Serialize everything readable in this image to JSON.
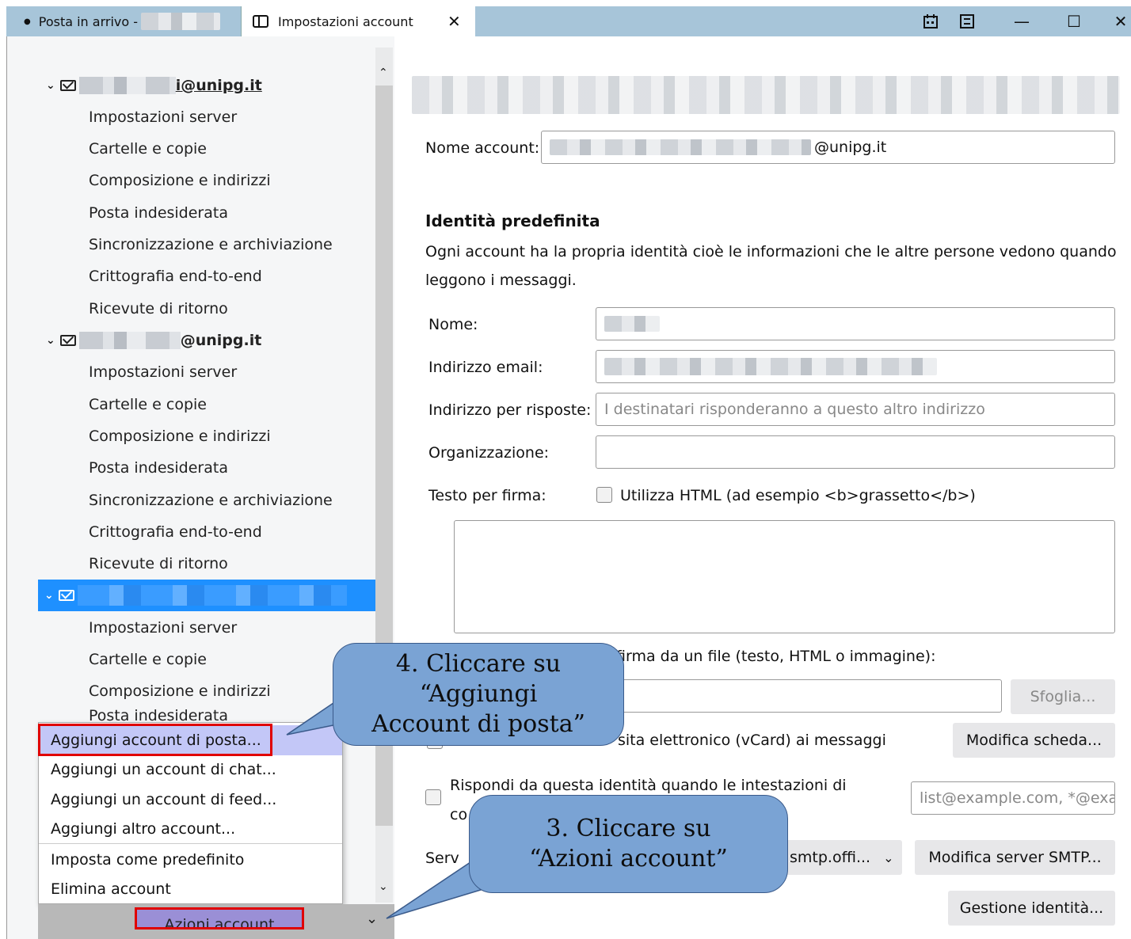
{
  "titlebar": {
    "tab1_label": "Posta in arrivo -",
    "tab2_label": "Impostazioni account",
    "close_tab": "✕",
    "minimize": "—",
    "maximize": "☐",
    "close": "✕"
  },
  "tree": {
    "account1_suffix": "i@unipg.it",
    "account2_suffix": "@unipg.it",
    "items": [
      "Impostazioni server",
      "Cartelle e copie",
      "Composizione e indirizzi",
      "Posta indesiderata",
      "Sincronizzazione e archiviazione",
      "Crittografia end-to-end",
      "Ricevute di ritorno"
    ],
    "partial_item": "Posta indesiderata"
  },
  "menu": {
    "items": [
      "Aggiungi account di posta...",
      "Aggiungi un account di chat...",
      "Aggiungi un account di feed...",
      "Aggiungi altro account...",
      "Imposta come predefinito",
      "Elimina account"
    ]
  },
  "action_button": "Azioni account",
  "settings": {
    "account_name_label": "Nome account:",
    "account_name_suffix": "@unipg.it",
    "identity_heading": "Identità predefinita",
    "identity_desc_1": "Ogni account ha la propria identità cioè le informazioni che le altre persone vedono quando",
    "identity_desc_2": "leggono i messaggi.",
    "name_label": "Nome:",
    "email_label": "Indirizzo email:",
    "reply_label": "Indirizzo per risposte:",
    "reply_placeholder": "I destinatari risponderanno a questo altro indirizzo",
    "org_label": "Organizzazione:",
    "sig_label": "Testo per firma:",
    "html_checkbox": "Utilizza HTML (ad esempio <b>grassetto</b>)",
    "file_sig_text": "firma da un file (testo, HTML o immagine):",
    "browse_button": "Sfoglia...",
    "vcard_text": "sita elettronico (vCard) ai messaggi",
    "edit_card_button": "Modifica scheda...",
    "reply_identity_1": "Rispondi da questa identità quando le intestazioni di",
    "reply_identity_2": "co",
    "list_placeholder": "list@example.com, *@exa",
    "smtp_label": "Serv",
    "smtp_value": "smtp.offi...",
    "edit_smtp_button": "Modifica server SMTP...",
    "manage_identity_button": "Gestione identità..."
  },
  "callouts": {
    "step4_line1": "4. Cliccare su “Aggiungi",
    "step4_line2": "Account di posta”",
    "step3_line1": "3. Cliccare su",
    "step3_line2": "“Azioni account”"
  }
}
